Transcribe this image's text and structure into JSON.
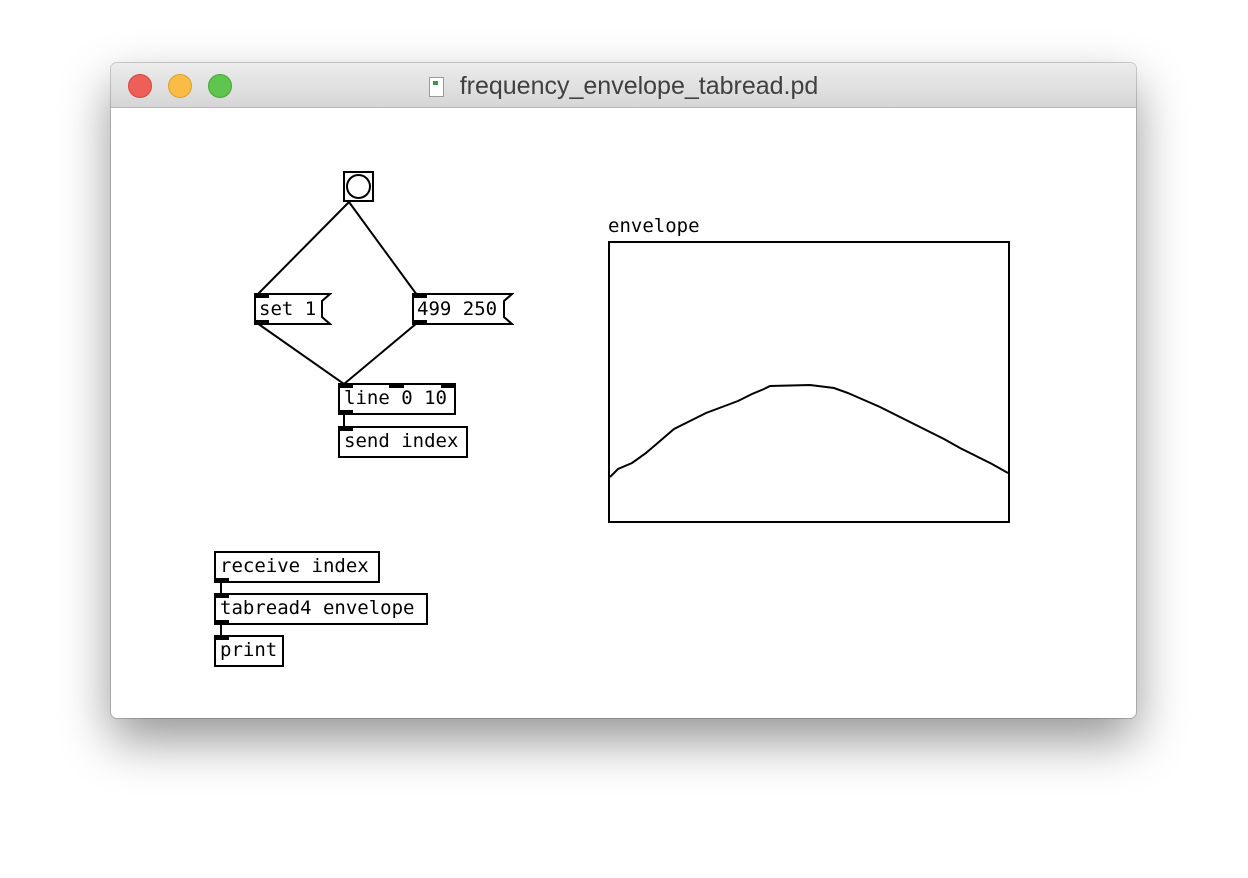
{
  "window": {
    "title": "frequency_envelope_tabread.pd"
  },
  "patch": {
    "bang": {
      "type": "bng"
    },
    "msg_set": {
      "text": "set 1"
    },
    "msg_range": {
      "text": "499 250"
    },
    "obj_line": {
      "text": "line 0 10"
    },
    "obj_send": {
      "text": "send index"
    },
    "obj_receive": {
      "text": "receive index"
    },
    "obj_tabread": {
      "text": "tabread4 envelope"
    },
    "obj_print": {
      "text": "print"
    },
    "array": {
      "name": "envelope"
    }
  },
  "colors": {
    "close": "#ee5f58",
    "minimize": "#f9bd45",
    "maximize": "#5fc54f",
    "ink": "#000000",
    "canvas": "#ffffff"
  }
}
